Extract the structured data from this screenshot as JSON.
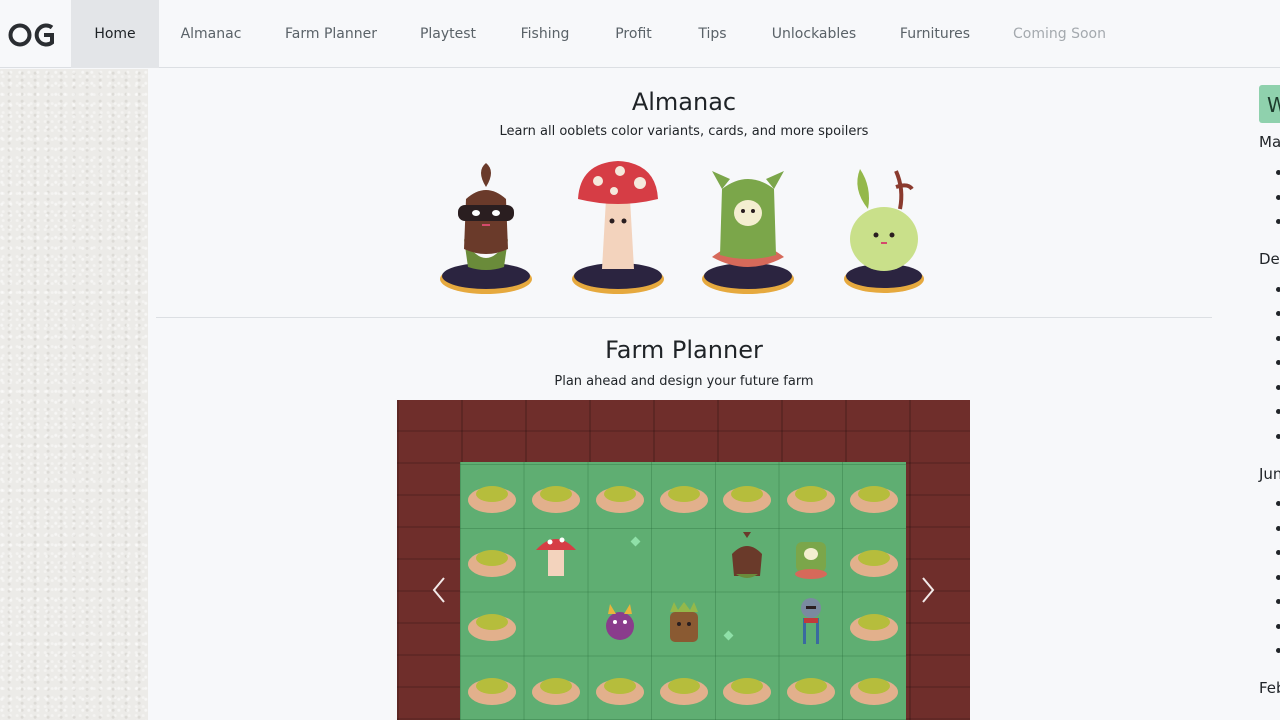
{
  "nav": {
    "logo": "OG",
    "items": [
      {
        "label": "Home",
        "state": "active"
      },
      {
        "label": "Almanac",
        "state": "normal"
      },
      {
        "label": "Farm Planner",
        "state": "normal"
      },
      {
        "label": "Playtest",
        "state": "normal"
      },
      {
        "label": "Fishing",
        "state": "normal"
      },
      {
        "label": "Profit",
        "state": "normal"
      },
      {
        "label": "Tips",
        "state": "normal"
      },
      {
        "label": "Unlockables",
        "state": "normal"
      },
      {
        "label": "Furnitures",
        "state": "normal"
      },
      {
        "label": "Coming Soon",
        "state": "disabled"
      }
    ]
  },
  "almanac": {
    "title": "Almanac",
    "subtitle": "Learn all ooblets color variants, cards, and more spoilers",
    "figures": [
      "dark-leaf-ooblet",
      "mushroom-ooblet",
      "cactus-ooblet",
      "sprout-ooblet"
    ]
  },
  "farm_planner": {
    "title": "Farm Planner",
    "subtitle": "Plan ahead and design your future farm",
    "prev_icon": "chevron-left-icon",
    "next_icon": "chevron-right-icon",
    "colors": {
      "soil": "#6f2e2b",
      "grass": "#5fae72",
      "bush": "#b6bd3c"
    }
  },
  "sidebar": {
    "header": "W",
    "groups": [
      {
        "label": "Ma",
        "bullets": 3
      },
      {
        "label": "De",
        "bullets": 7
      },
      {
        "label": "Jun",
        "bullets": 7
      },
      {
        "label": "Feb",
        "bullets": 0
      }
    ]
  }
}
